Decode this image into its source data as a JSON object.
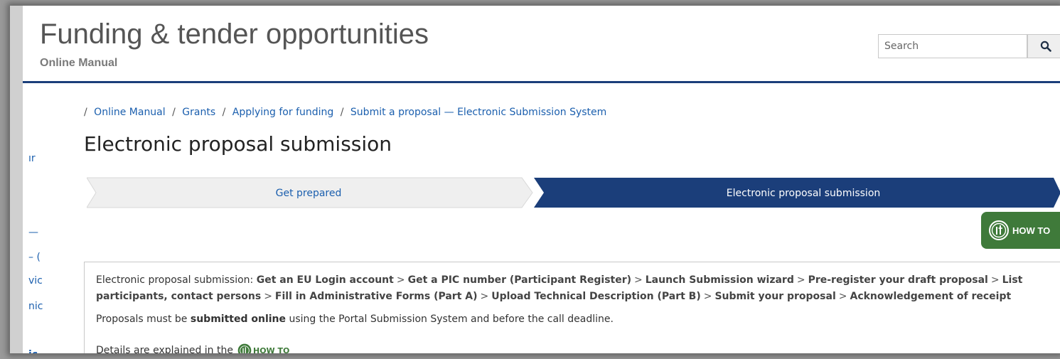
{
  "header": {
    "site_title": "Funding & tender opportunities",
    "site_subtitle": "Online Manual",
    "search_placeholder": "Search",
    "search_icon": "magnifier-icon"
  },
  "side_nav": {
    "items": [
      "ır",
      "—",
      "– (",
      "vic",
      "nic",
      "ic"
    ]
  },
  "breadcrumb": {
    "items": [
      "Online Manual",
      "Grants",
      "Applying for funding",
      "Submit a proposal — Electronic Submission System"
    ]
  },
  "page_title": "Electronic proposal submission",
  "steps": {
    "items": [
      "Get prepared",
      "Electronic proposal submission"
    ],
    "active_index": 1
  },
  "how_to": {
    "label": "HOW TO",
    "icon": "it-logo-icon"
  },
  "content": {
    "intro_label": "Electronic proposal submission:",
    "step_links": [
      "Get an EU Login account",
      "Get a PIC number (Participant Register)",
      "Launch Submission wizard",
      "Pre-register your draft proposal",
      "List participants, contact persons",
      "Fill in Administrative Forms (Part A)",
      "Upload Technical Description (Part B)",
      "Submit your proposal",
      "Acknowledgement of receipt"
    ],
    "separator": ">",
    "note_before": "Proposals must be",
    "note_bold": "submitted online",
    "note_after": "using the Portal Submission System and before the call deadline.",
    "details_text": "Details are explained in the",
    "details_badge": "HOW TO"
  },
  "colors": {
    "brand_blue": "#1b3e7a",
    "link_blue": "#1b5fae",
    "how_to_green": "#3f7a3a",
    "step_inactive": "#efefef"
  }
}
